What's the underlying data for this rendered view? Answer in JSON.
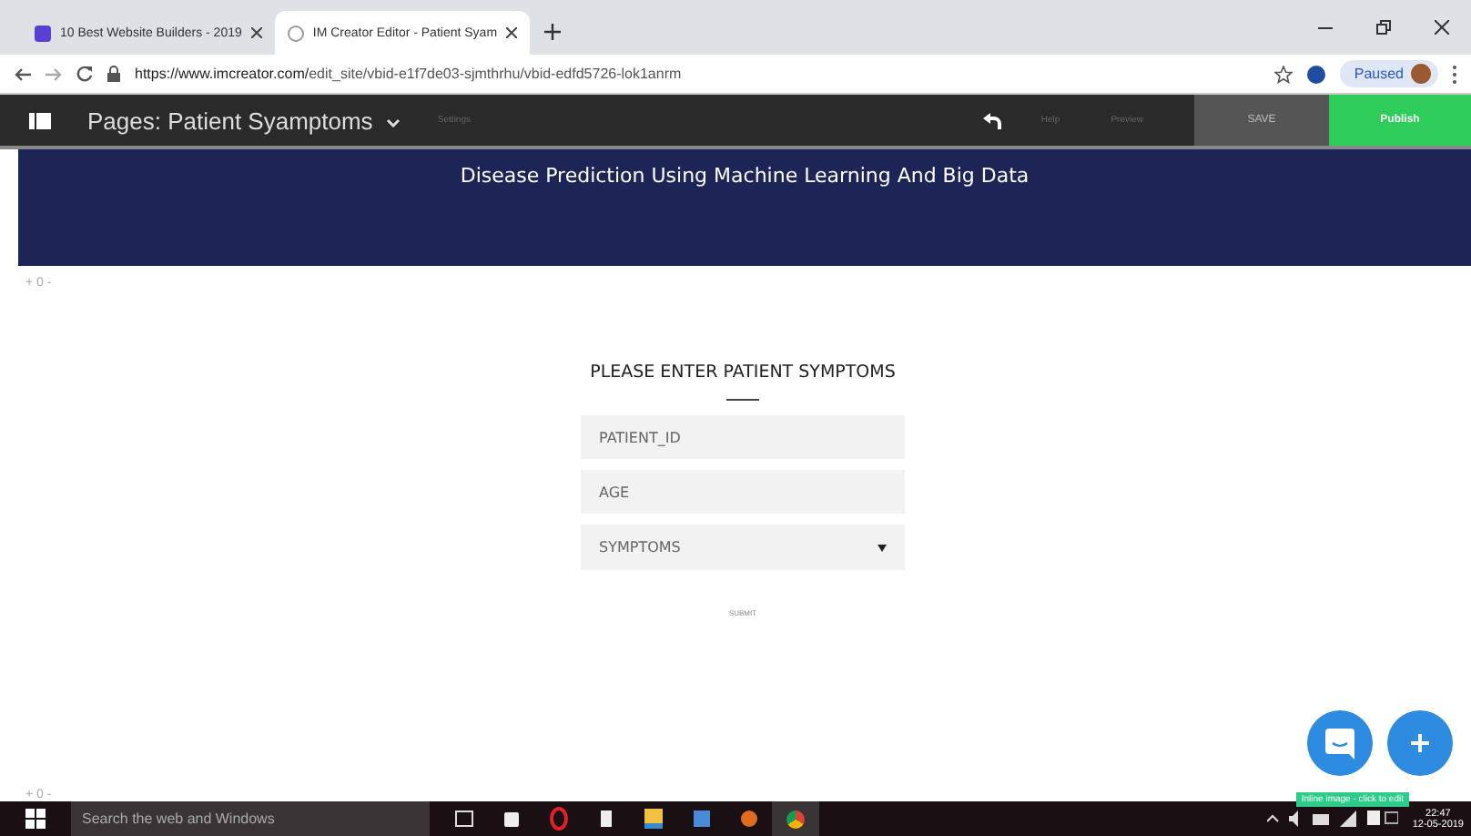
{
  "browser_tabs": [
    {
      "title": "10 Best Website Builders - 2019",
      "selected": false,
      "kind": "site"
    },
    {
      "title": "IM Creator Editor - Patient Syam",
      "selected": true,
      "kind": "loading"
    }
  ],
  "address": {
    "host": "https://www.imcreator.com/",
    "path": "edit_site/vbid-e1f7de03-sjmthrhu/vbid-edfd5726-lok1anrm"
  },
  "profile": {
    "label": "Paused"
  },
  "editor": {
    "page_menu": "Pages: Patient Syamptoms",
    "settings": "Settings",
    "help": "Help",
    "preview": "Preview",
    "save": "SAVE",
    "publish": "Publish"
  },
  "banner": {
    "title": "Disease Prediction Using Machine Learning And Big Data"
  },
  "spacers": [
    "+ 0 -",
    "+ 0 -"
  ],
  "form": {
    "heading": "PLEASE ENTER PATIENT SYMPTOMS",
    "fields": [
      {
        "kind": "text",
        "placeholder": "PATIENT_ID"
      },
      {
        "kind": "text",
        "placeholder": "AGE"
      },
      {
        "kind": "select",
        "value": "SYMPTOMS"
      }
    ],
    "submit": "SUBMIT"
  },
  "tooltip": "Inline image - click to edit",
  "taskbar": {
    "search_placeholder": "Search the web and Windows",
    "time": "22:47",
    "date": "12-05-2019"
  }
}
